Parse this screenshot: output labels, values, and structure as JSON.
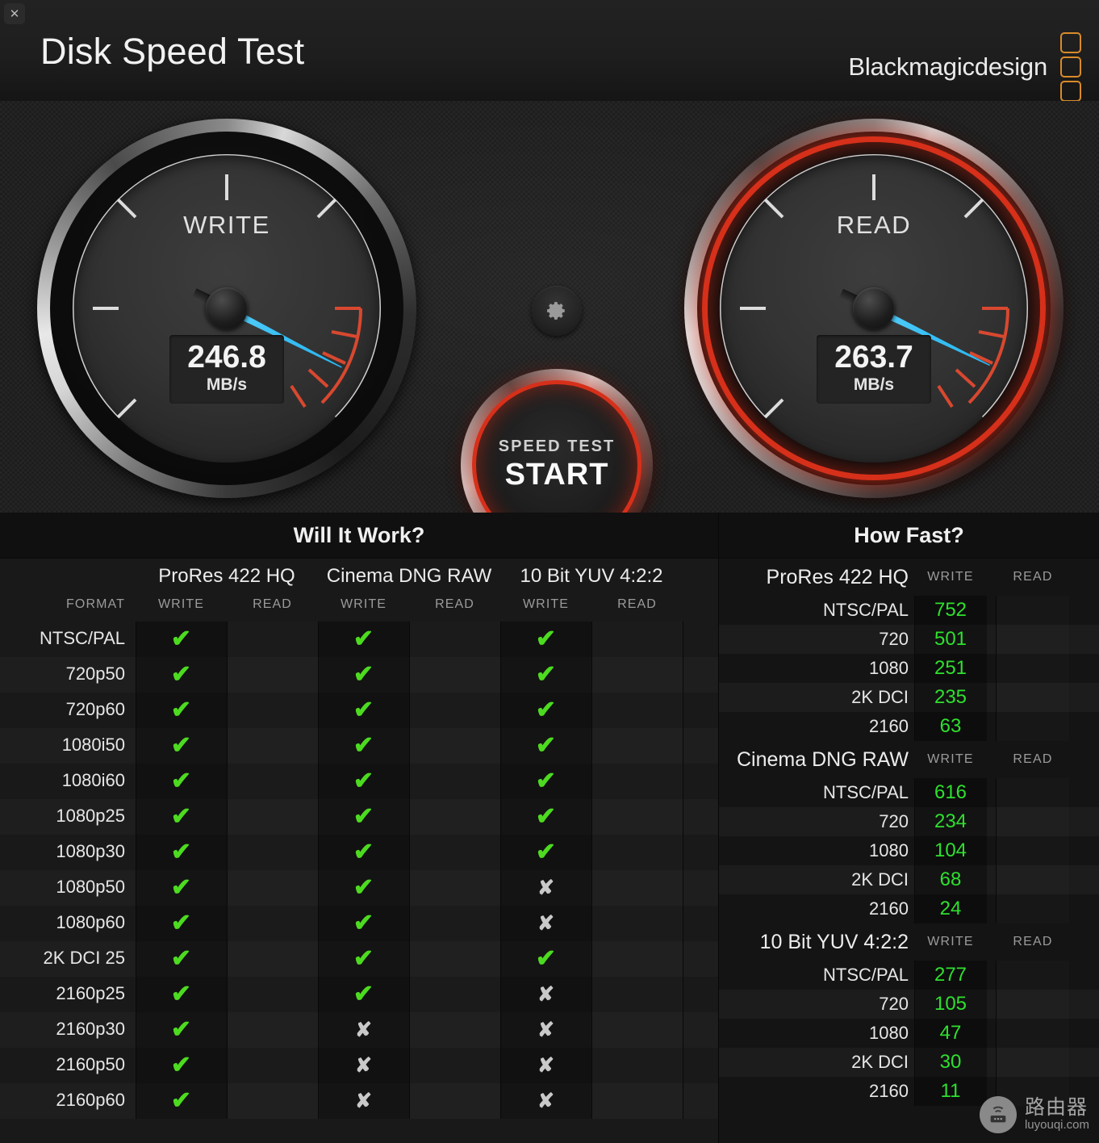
{
  "window": {
    "close_label": "✕",
    "title": "Disk Speed Test",
    "brand": "Blackmagicdesign",
    "brand_mark_color": "#d98a2b"
  },
  "gauges": {
    "accent_needle_color": "#39c0f5",
    "active_ring_color": "#d6301a",
    "write": {
      "label": "WRITE",
      "value": "246.8",
      "unit": "MB/s",
      "needle_angle_deg": 207
    },
    "read": {
      "label": "READ",
      "value": "263.7",
      "unit": "MB/s",
      "needle_angle_deg": 206
    }
  },
  "controls": {
    "gear_icon": "gear-icon",
    "start_sub_label": "SPEED TEST",
    "start_main_label": "START"
  },
  "will_it_work": {
    "title": "Will It Work?",
    "format_label": "FORMAT",
    "codec_groups": [
      "ProRes 422 HQ",
      "Cinema DNG RAW",
      "10 Bit YUV 4:2:2"
    ],
    "sub_headers": [
      "WRITE",
      "READ"
    ],
    "ok_glyph": "✔",
    "no_glyph": "✘",
    "rows": [
      {
        "format": "NTSC/PAL",
        "cells": [
          "ok",
          "",
          "ok",
          "",
          "ok",
          ""
        ]
      },
      {
        "format": "720p50",
        "cells": [
          "ok",
          "",
          "ok",
          "",
          "ok",
          ""
        ]
      },
      {
        "format": "720p60",
        "cells": [
          "ok",
          "",
          "ok",
          "",
          "ok",
          ""
        ]
      },
      {
        "format": "1080i50",
        "cells": [
          "ok",
          "",
          "ok",
          "",
          "ok",
          ""
        ]
      },
      {
        "format": "1080i60",
        "cells": [
          "ok",
          "",
          "ok",
          "",
          "ok",
          ""
        ]
      },
      {
        "format": "1080p25",
        "cells": [
          "ok",
          "",
          "ok",
          "",
          "ok",
          ""
        ]
      },
      {
        "format": "1080p30",
        "cells": [
          "ok",
          "",
          "ok",
          "",
          "ok",
          ""
        ]
      },
      {
        "format": "1080p50",
        "cells": [
          "ok",
          "",
          "ok",
          "",
          "no",
          ""
        ]
      },
      {
        "format": "1080p60",
        "cells": [
          "ok",
          "",
          "ok",
          "",
          "no",
          ""
        ]
      },
      {
        "format": "2K DCI 25",
        "cells": [
          "ok",
          "",
          "ok",
          "",
          "ok",
          ""
        ]
      },
      {
        "format": "2160p25",
        "cells": [
          "ok",
          "",
          "ok",
          "",
          "no",
          ""
        ]
      },
      {
        "format": "2160p30",
        "cells": [
          "ok",
          "",
          "no",
          "",
          "no",
          ""
        ]
      },
      {
        "format": "2160p50",
        "cells": [
          "ok",
          "",
          "no",
          "",
          "no",
          ""
        ]
      },
      {
        "format": "2160p60",
        "cells": [
          "ok",
          "",
          "no",
          "",
          "no",
          ""
        ]
      }
    ]
  },
  "how_fast": {
    "title": "How Fast?",
    "sub_headers": [
      "WRITE",
      "READ"
    ],
    "value_color": "#2ee02e",
    "groups": [
      {
        "name": "ProRes 422 HQ",
        "rows": [
          {
            "label": "NTSC/PAL",
            "write": "752",
            "read": ""
          },
          {
            "label": "720",
            "write": "501",
            "read": ""
          },
          {
            "label": "1080",
            "write": "251",
            "read": ""
          },
          {
            "label": "2K DCI",
            "write": "235",
            "read": ""
          },
          {
            "label": "2160",
            "write": "63",
            "read": ""
          }
        ]
      },
      {
        "name": "Cinema DNG RAW",
        "rows": [
          {
            "label": "NTSC/PAL",
            "write": "616",
            "read": ""
          },
          {
            "label": "720",
            "write": "234",
            "read": ""
          },
          {
            "label": "1080",
            "write": "104",
            "read": ""
          },
          {
            "label": "2K DCI",
            "write": "68",
            "read": ""
          },
          {
            "label": "2160",
            "write": "24",
            "read": ""
          }
        ]
      },
      {
        "name": "10 Bit YUV 4:2:2",
        "rows": [
          {
            "label": "NTSC/PAL",
            "write": "277",
            "read": ""
          },
          {
            "label": "720",
            "write": "105",
            "read": ""
          },
          {
            "label": "1080",
            "write": "47",
            "read": ""
          },
          {
            "label": "2K DCI",
            "write": "30",
            "read": ""
          },
          {
            "label": "2160",
            "write": "11",
            "read": ""
          }
        ]
      }
    ]
  },
  "watermark": {
    "icon": "router-icon",
    "cn_text": "路由器",
    "url_text": "luyouqi.com"
  }
}
